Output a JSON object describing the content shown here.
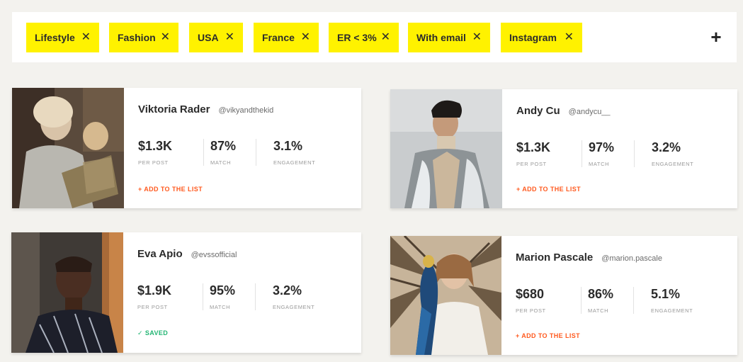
{
  "filters": {
    "chips": [
      {
        "label": "Lifestyle"
      },
      {
        "label": "Fashion"
      },
      {
        "label": "USA"
      },
      {
        "label": "France"
      },
      {
        "label": "ER < 3%"
      },
      {
        "label": "With email"
      },
      {
        "label": "Instagram"
      }
    ],
    "remove_glyph": "✕",
    "add_glyph": "+",
    "chip_color": "#fff200"
  },
  "influencers": [
    {
      "name": "Viktoria Rader",
      "handle": "@vikyandthekid",
      "stats": [
        {
          "value": "$1.3K",
          "label": "PER POST"
        },
        {
          "value": "87%",
          "label": "MATCH"
        },
        {
          "value": "3.1%",
          "label": "ENGAGEMENT"
        }
      ],
      "action": "+ ADD TO THE LIST"
    },
    {
      "name": "Andy Cu",
      "handle": "@andycu__",
      "stats": [
        {
          "value": "$1.3K",
          "label": "PER POST"
        },
        {
          "value": "97%",
          "label": "MATCH"
        },
        {
          "value": "3.2%",
          "label": "ENGAGEMENT"
        }
      ],
      "action": "+ ADD TO THE LIST"
    },
    {
      "name": "Eva Apio",
      "handle": "@evssofficial",
      "stats": [
        {
          "value": "$1.9K",
          "label": "PER POST"
        },
        {
          "value": "95%",
          "label": "MATCH"
        },
        {
          "value": "3.2%",
          "label": "ENGAGEMENT"
        }
      ],
      "action": "✓ SAVED"
    },
    {
      "name": "Marion Pascale",
      "handle": "@marion.pascale",
      "stats": [
        {
          "value": "$680",
          "label": "PER POST"
        },
        {
          "value": "86%",
          "label": "MATCH"
        },
        {
          "value": "5.1%",
          "label": "ENGAGEMENT"
        }
      ],
      "action": "+ ADD TO THE LIST"
    }
  ],
  "colors": {
    "accent_action": "#ff5a1f",
    "saved": "#22b573",
    "background": "#f3f2ee"
  }
}
